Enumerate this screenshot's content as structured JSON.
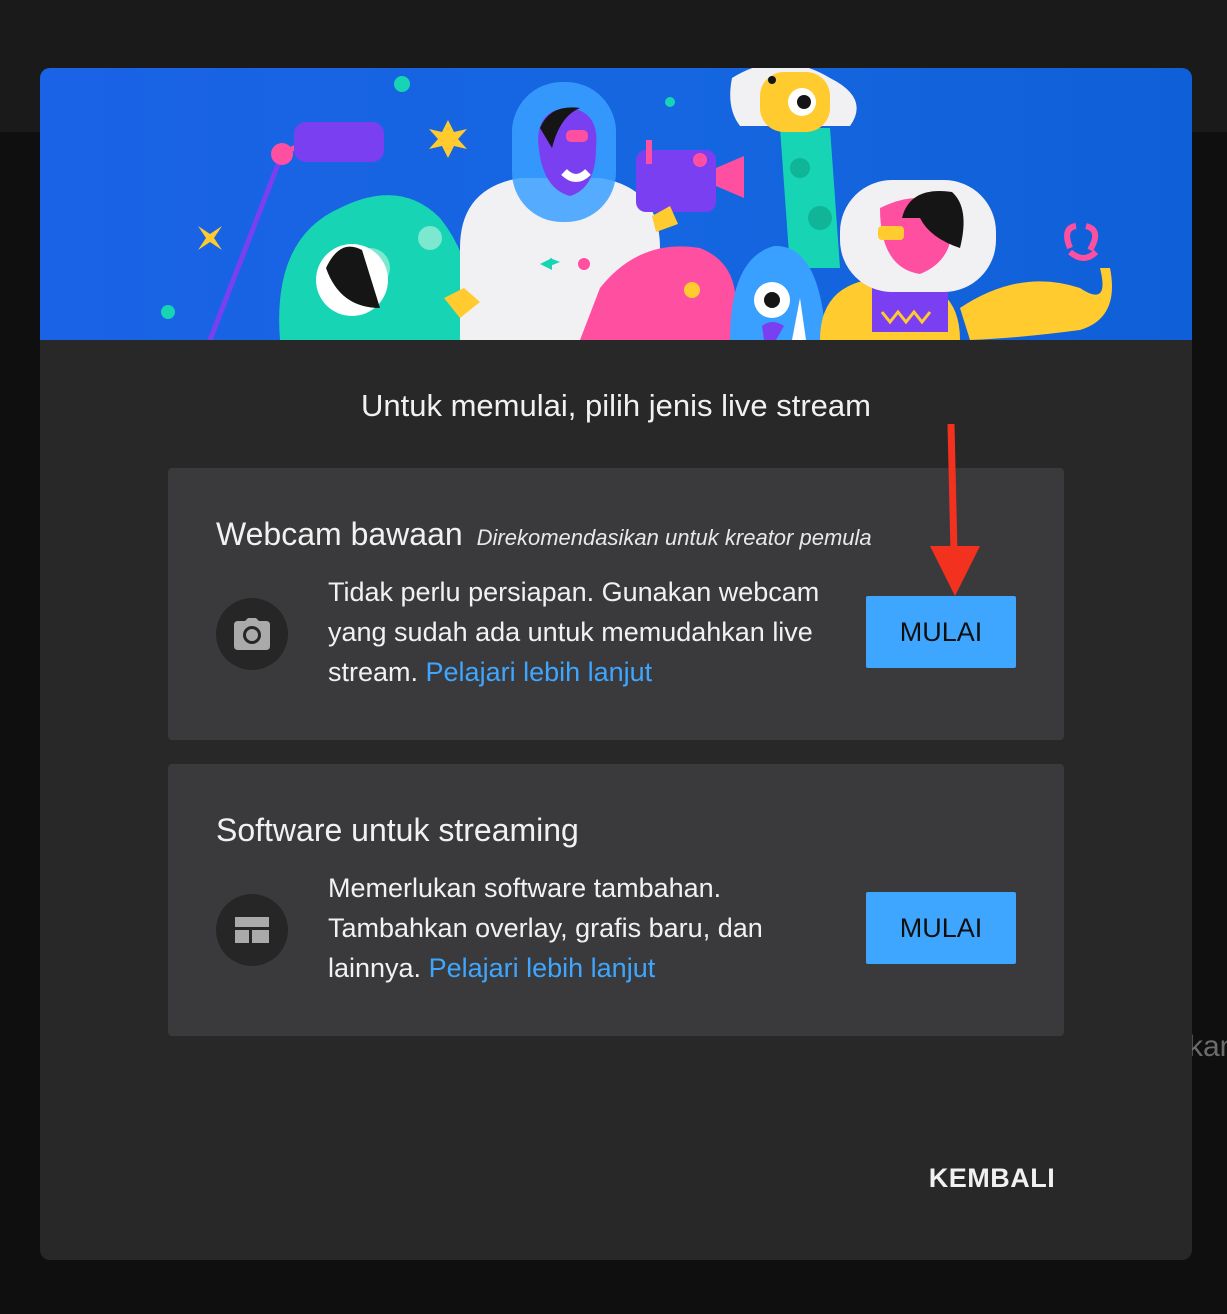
{
  "background": {
    "peek_text": "kan"
  },
  "dialog": {
    "heading": "Untuk memulai, pilih jenis live stream",
    "options": [
      {
        "title": "Webcam bawaan",
        "tag": "Direkomendasikan untuk kreator pemula",
        "description": "Tidak perlu persiapan. Gunakan webcam yang sudah ada untuk memudahkan live stream. ",
        "link": "Pelajari lebih lanjut",
        "button": "MULAI",
        "icon": "camera-icon"
      },
      {
        "title": "Software untuk streaming",
        "description": "Memerlukan software tambahan. Tambahkan overlay, grafis baru, dan lainnya. ",
        "link": "Pelajari lebih lanjut",
        "button": "MULAI",
        "icon": "layout-icon"
      }
    ],
    "back_button": "KEMBALI"
  },
  "colors": {
    "accent": "#3ea6ff",
    "annotation_arrow": "#f2321e",
    "banner_blue": "#1566e0"
  }
}
